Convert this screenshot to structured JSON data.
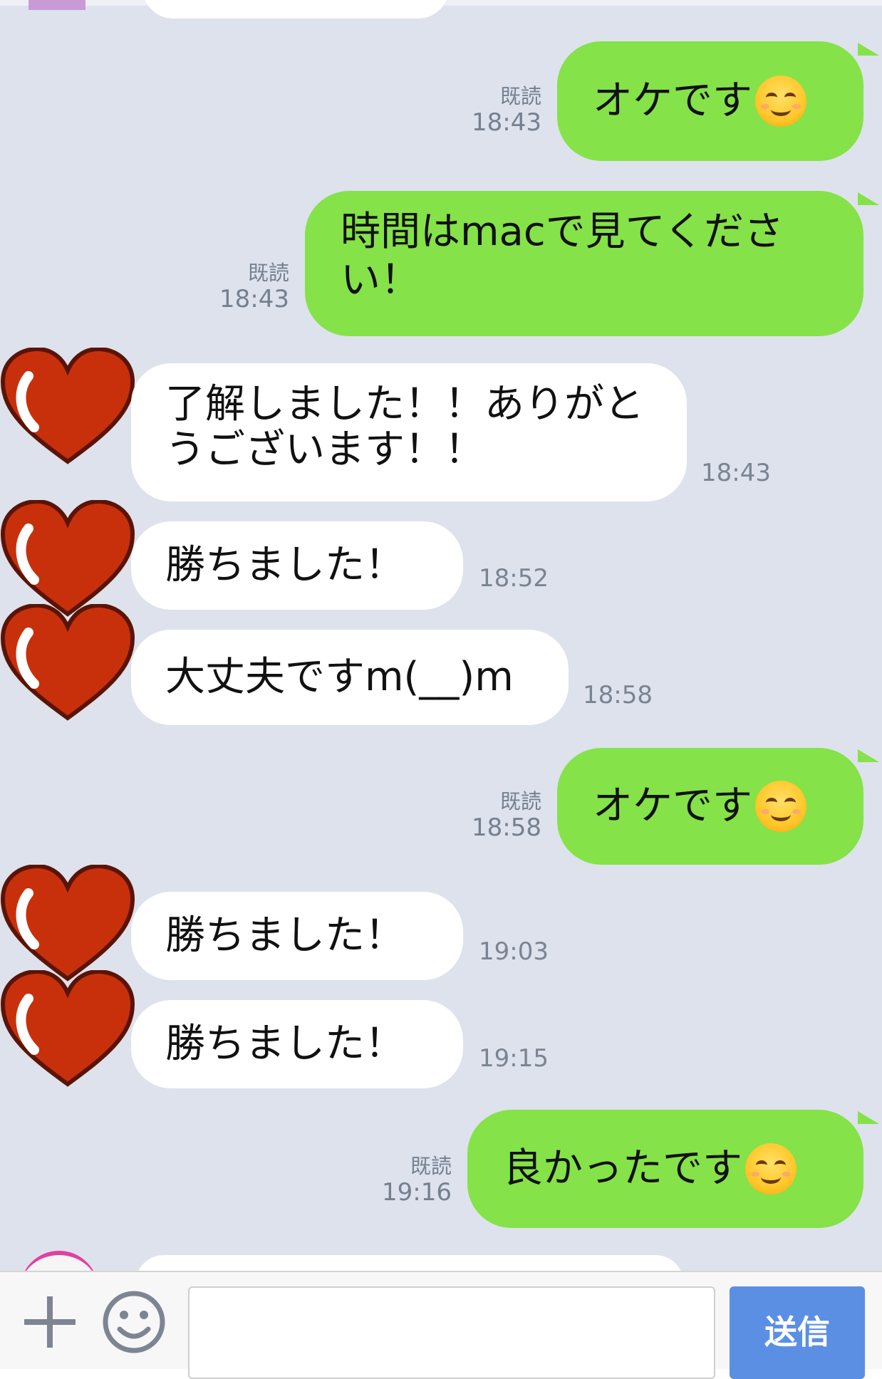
{
  "messages": [
    {
      "dir": "out",
      "text": "オケです",
      "emoji": "smiling-face",
      "read": "既読",
      "time": "18:43"
    },
    {
      "dir": "out",
      "text": "時間はmacで見てください！",
      "read": "既読",
      "time": "18:43"
    },
    {
      "dir": "in",
      "text": "了解しました！！ありがとうございます！！",
      "time": "18:43"
    },
    {
      "dir": "in",
      "text": "勝ちました！",
      "time": "18:52"
    },
    {
      "dir": "in",
      "text": "大丈夫ですm(__)m",
      "time": "18:58"
    },
    {
      "dir": "out",
      "text": "オケです",
      "emoji": "smiling-face",
      "read": "既読",
      "time": "18:58"
    },
    {
      "dir": "in",
      "text": "勝ちました！",
      "time": "19:03"
    },
    {
      "dir": "in",
      "text": "勝ちました！",
      "time": "19:15"
    },
    {
      "dir": "out",
      "text": "良かったです",
      "emoji": "smiling-face",
      "read": "既読",
      "time": "19:16"
    }
  ],
  "input_bar": {
    "plus_icon": "plus-icon",
    "sticker_icon": "smiley-icon",
    "message_value": "",
    "send_label": "送信"
  },
  "colors": {
    "chat_background": "#dde2ed",
    "outgoing_bubble": "#85e249",
    "incoming_bubble": "#ffffff",
    "send_button": "#5b8fe3",
    "avatar_heart": "#c8300c"
  }
}
